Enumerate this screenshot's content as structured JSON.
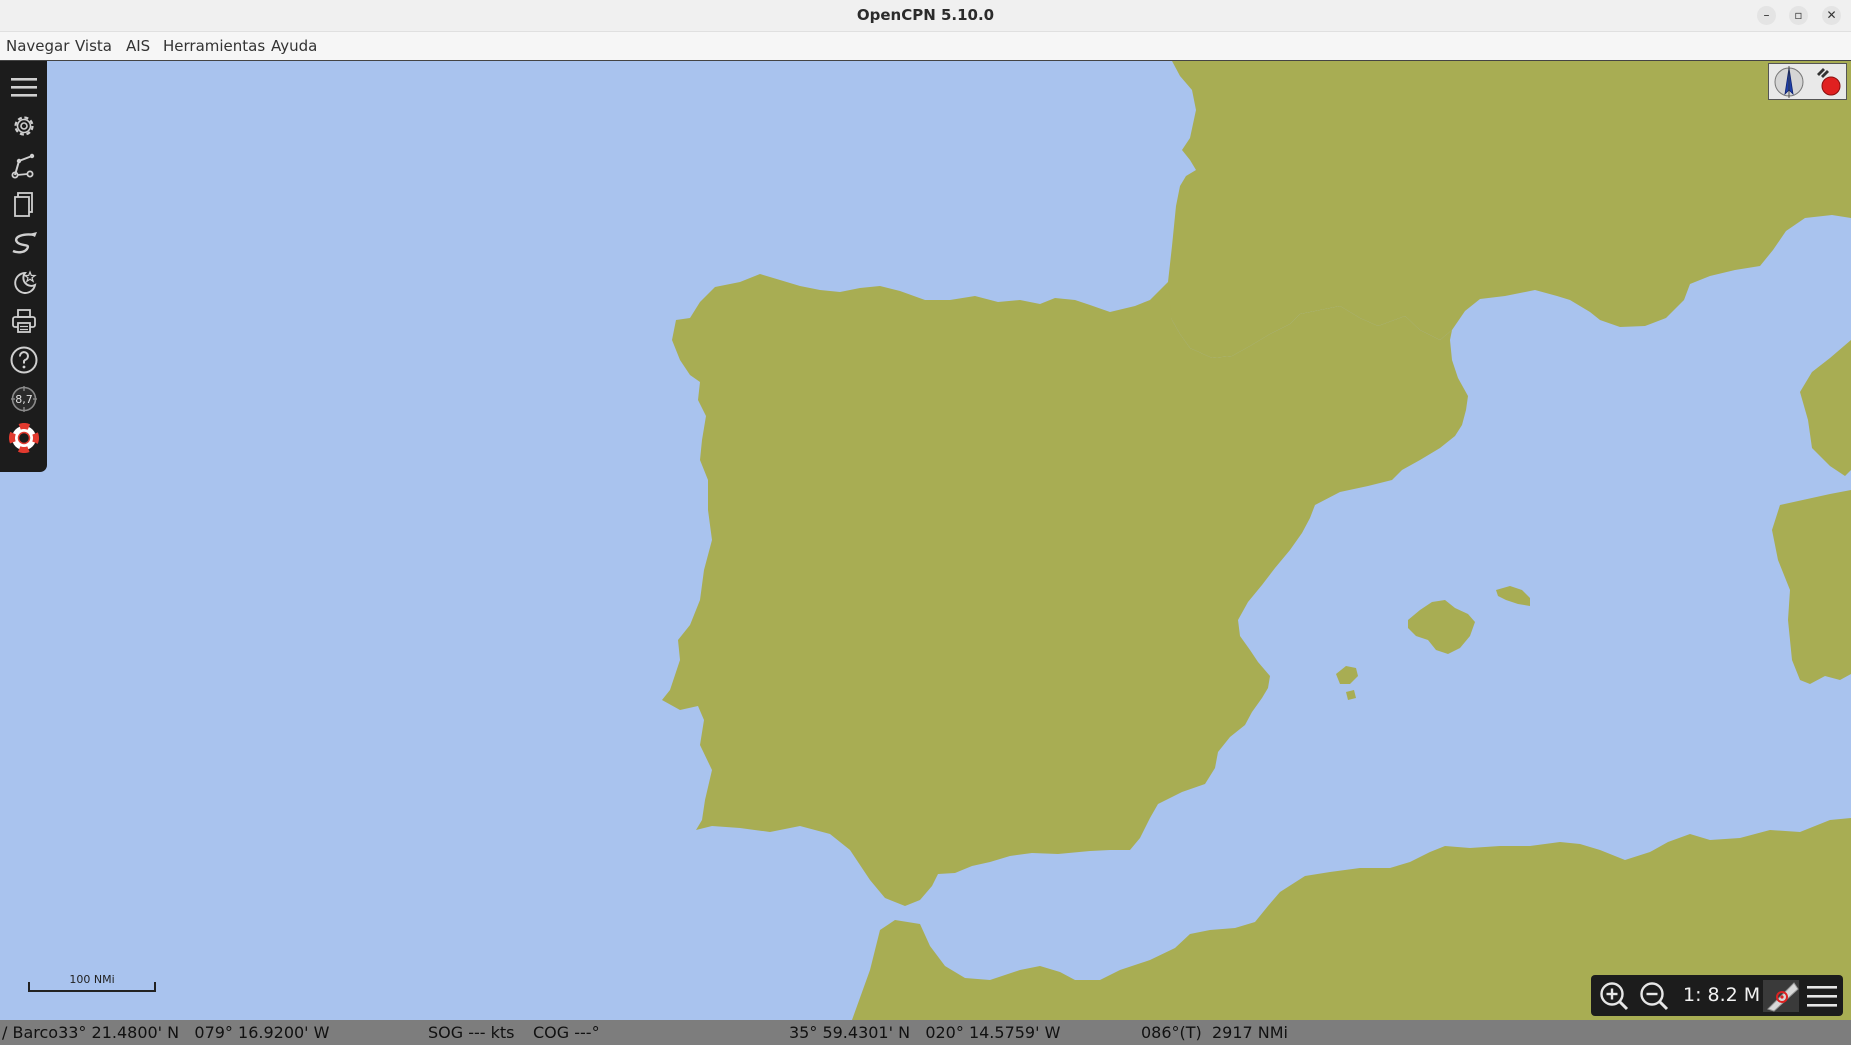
{
  "window": {
    "title": "OpenCPN 5.10.0",
    "minimize_glyph": "–",
    "maximize_glyph": "▫",
    "close_glyph": "✕"
  },
  "menu": [
    "Navegar",
    "Vista",
    "AIS",
    "Herramientas",
    "Ayuda"
  ],
  "toolbar": {
    "items": [
      {
        "icon": "hamburger-menu-icon"
      },
      {
        "icon": "gear-icon"
      },
      {
        "icon": "route-icon"
      },
      {
        "icon": "layers-document-icon"
      },
      {
        "icon": "track-icon"
      },
      {
        "icon": "night-mode-icon"
      },
      {
        "icon": "print-icon"
      },
      {
        "icon": "help-icon"
      },
      {
        "icon": "compass-badge-icon",
        "badge": "8,7"
      },
      {
        "icon": "mob-lifebuoy-icon"
      }
    ]
  },
  "colors": {
    "sea": "#a9c3ee",
    "land": "#a8ad53",
    "toolbar": "#1c1c1c",
    "statusbar": "#7d7d7d",
    "mob_red": "#e23a2f"
  },
  "scale_bar": {
    "label": "100 NMi"
  },
  "zoom_panel": {
    "scale_text": "1: 8.2 M"
  },
  "status": {
    "boat": "/ Barco33° 21.4800' N   079° 16.9200' W",
    "sog": "SOG --- kts",
    "cog": "COG ---°",
    "cursor": "35° 59.4301' N   020° 14.5759' W",
    "bearing": "086°(T)  2917 NMi"
  }
}
